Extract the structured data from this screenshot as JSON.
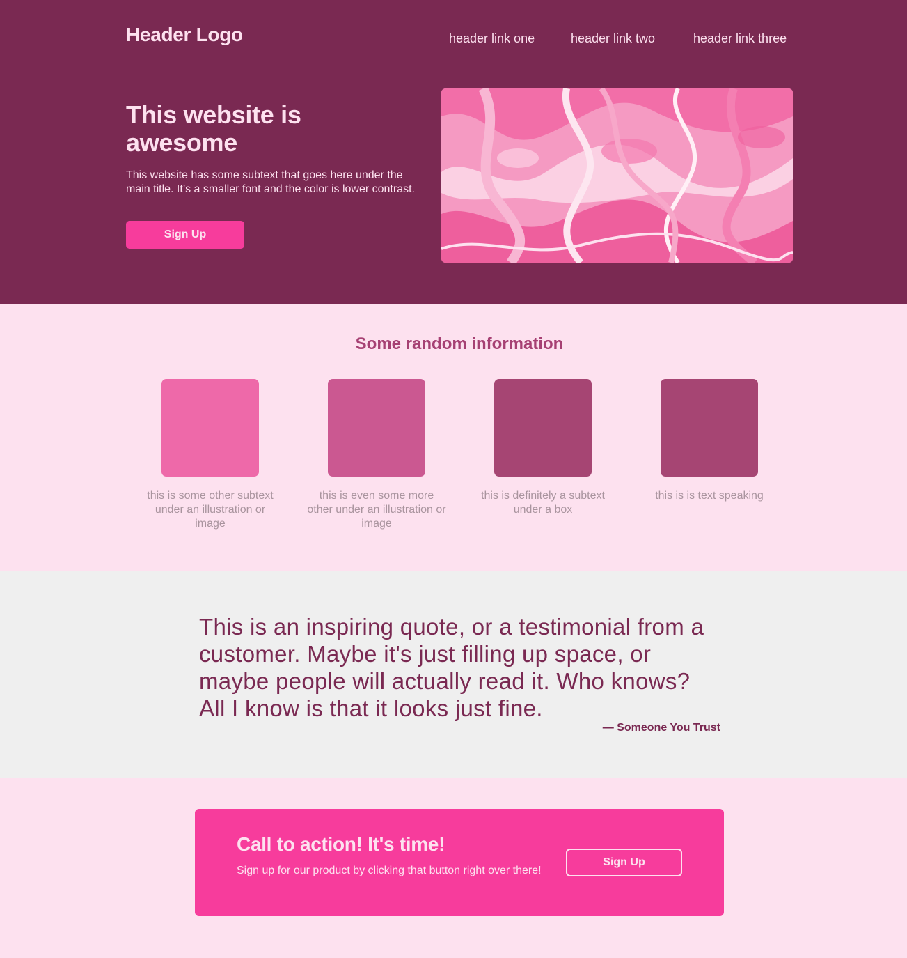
{
  "header": {
    "logo": "Header Logo",
    "links": [
      "header link one",
      "header link two",
      "header link three"
    ]
  },
  "hero": {
    "title": "This website is awesome",
    "subtitle": "This website has some subtext that goes here under the main title. It’s a smaller font and the color is lower contrast.",
    "button_label": "Sign Up"
  },
  "info": {
    "title": "Some random information",
    "cards": [
      {
        "caption": "this is some other subtext under an illustration or image",
        "color": "#ee69a9"
      },
      {
        "caption": "this is even some more other under an illustration or image",
        "color": "#cb5891"
      },
      {
        "caption": "this is definitely a subtext under a box",
        "color": "#a64573"
      },
      {
        "caption": "this is is text speaking",
        "color": "#a64573"
      }
    ]
  },
  "quote": {
    "text": "This is an inspiring quote, or a testimonial from a customer. Maybe it's just filling up space, or maybe people will actually read it. Who knows? All I know is that it looks just fine.",
    "author": "— Someone You Trust"
  },
  "cta": {
    "title": "Call to action! It's time!",
    "subtitle": "Sign up for our product by clicking that button right over there!",
    "button_label": "Sign Up"
  },
  "colors": {
    "hero_bg": "#7a2952",
    "page_bg": "#fde1ef",
    "accent": "#f73c9c",
    "quote_bg": "#efefef"
  }
}
